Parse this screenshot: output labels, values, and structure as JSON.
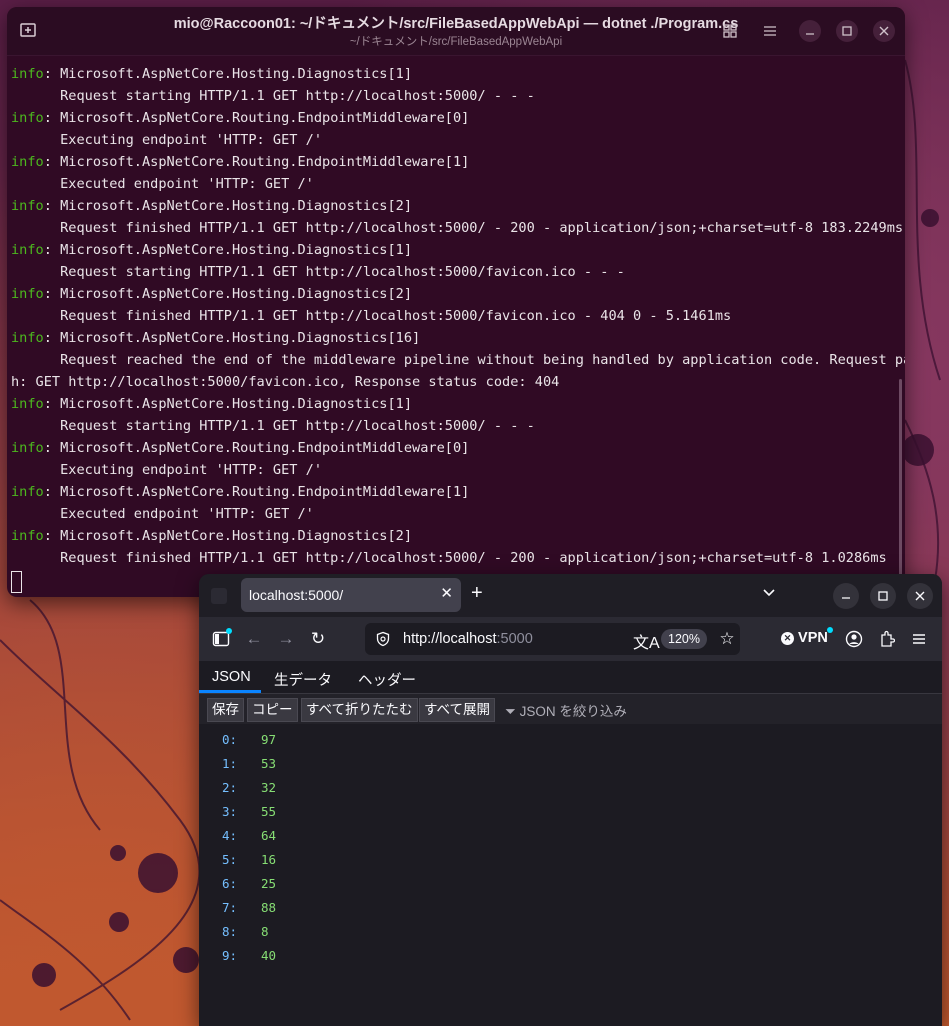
{
  "terminal": {
    "title": "mio@Raccoon01: ~/ドキュメント/src/FileBasedAppWebApi — dotnet ./Program.cs",
    "subtitle": "~/ドキュメント/src/FileBasedAppWebApi",
    "lines": [
      {
        "level": "info",
        "text": ": Microsoft.AspNetCore.Hosting.Diagnostics[1]"
      },
      {
        "level": "",
        "text": "      Request starting HTTP/1.1 GET http://localhost:5000/ - - -"
      },
      {
        "level": "info",
        "text": ": Microsoft.AspNetCore.Routing.EndpointMiddleware[0]"
      },
      {
        "level": "",
        "text": "      Executing endpoint 'HTTP: GET /'"
      },
      {
        "level": "info",
        "text": ": Microsoft.AspNetCore.Routing.EndpointMiddleware[1]"
      },
      {
        "level": "",
        "text": "      Executed endpoint 'HTTP: GET /'"
      },
      {
        "level": "info",
        "text": ": Microsoft.AspNetCore.Hosting.Diagnostics[2]"
      },
      {
        "level": "",
        "text": "      Request finished HTTP/1.1 GET http://localhost:5000/ - 200 - application/json;+charset=utf-8 183.2249ms"
      },
      {
        "level": "info",
        "text": ": Microsoft.AspNetCore.Hosting.Diagnostics[1]"
      },
      {
        "level": "",
        "text": "      Request starting HTTP/1.1 GET http://localhost:5000/favicon.ico - - -"
      },
      {
        "level": "info",
        "text": ": Microsoft.AspNetCore.Hosting.Diagnostics[2]"
      },
      {
        "level": "",
        "text": "      Request finished HTTP/1.1 GET http://localhost:5000/favicon.ico - 404 0 - 5.1461ms"
      },
      {
        "level": "info",
        "text": ": Microsoft.AspNetCore.Hosting.Diagnostics[16]"
      },
      {
        "level": "",
        "text": "      Request reached the end of the middleware pipeline without being handled by application code. Request pat"
      },
      {
        "level": "",
        "text": "h: GET http://localhost:5000/favicon.ico, Response status code: 404"
      },
      {
        "level": "info",
        "text": ": Microsoft.AspNetCore.Hosting.Diagnostics[1]"
      },
      {
        "level": "",
        "text": "      Request starting HTTP/1.1 GET http://localhost:5000/ - - -"
      },
      {
        "level": "info",
        "text": ": Microsoft.AspNetCore.Routing.EndpointMiddleware[0]"
      },
      {
        "level": "",
        "text": "      Executing endpoint 'HTTP: GET /'"
      },
      {
        "level": "info",
        "text": ": Microsoft.AspNetCore.Routing.EndpointMiddleware[1]"
      },
      {
        "level": "",
        "text": "      Executed endpoint 'HTTP: GET /'"
      },
      {
        "level": "info",
        "text": ": Microsoft.AspNetCore.Hosting.Diagnostics[2]"
      },
      {
        "level": "",
        "text": "      Request finished HTTP/1.1 GET http://localhost:5000/ - 200 - application/json;+charset=utf-8 1.0286ms"
      }
    ],
    "icons": [
      "new-tab-icon",
      "grid-icon",
      "hamburger-menu-icon",
      "minimize-icon",
      "maximize-icon",
      "close-icon"
    ]
  },
  "browser": {
    "tab_title": "localhost:5000/",
    "url_host": "http://localhost",
    "url_port": ":5000",
    "zoom": "120%",
    "vpn_label": "VPN",
    "json_tabs": [
      "JSON",
      "生データ",
      "ヘッダー"
    ],
    "toolbar": {
      "save": "保存",
      "copy": "コピー",
      "collapse_all": "すべて折りたたむ",
      "expand_all": "すべて展開",
      "filter_placeholder": "JSON を絞り込み"
    },
    "json_rows": [
      {
        "key": "0:",
        "value": "97"
      },
      {
        "key": "1:",
        "value": "53"
      },
      {
        "key": "2:",
        "value": "32"
      },
      {
        "key": "3:",
        "value": "55"
      },
      {
        "key": "4:",
        "value": "64"
      },
      {
        "key": "5:",
        "value": "16"
      },
      {
        "key": "6:",
        "value": "25"
      },
      {
        "key": "7:",
        "value": "88"
      },
      {
        "key": "8:",
        "value": "8"
      },
      {
        "key": "9:",
        "value": "40"
      }
    ]
  },
  "colors": {
    "terminal_bg": "#300a24",
    "log_level": "#4cb81e",
    "json_key": "#75bfff",
    "json_value": "#86de74",
    "accent": "#0a84ff"
  }
}
